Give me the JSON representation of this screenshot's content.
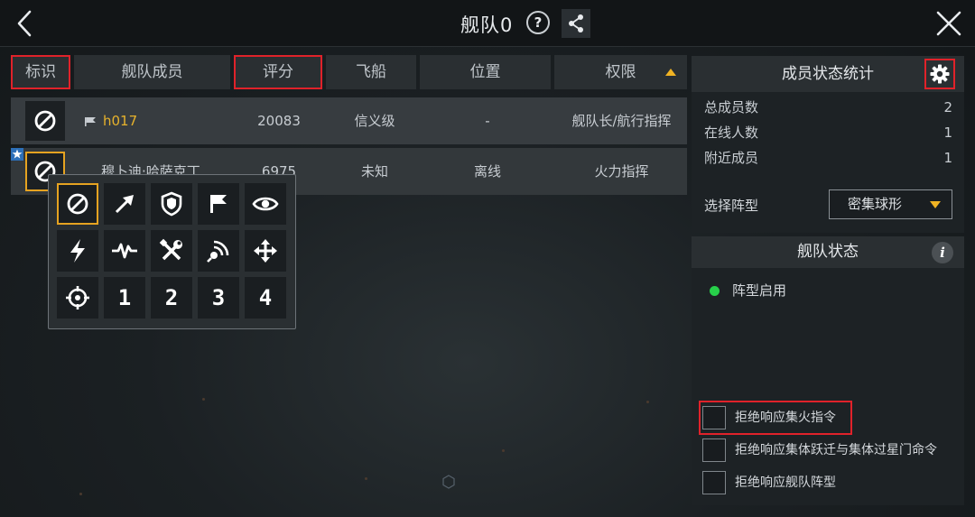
{
  "header": {
    "title": "舰队0",
    "help_label": "?"
  },
  "tabs": [
    {
      "label": "标识"
    },
    {
      "label": "舰队成员"
    },
    {
      "label": "评分"
    },
    {
      "label": "飞船"
    },
    {
      "label": "位置"
    },
    {
      "label": "权限"
    }
  ],
  "members": [
    {
      "name": "h017",
      "score": "20083",
      "ship": "信义级",
      "location": "-",
      "role": "舰队长/航行指挥"
    },
    {
      "name": "穆卜迪·哈萨克丁",
      "score": "6975",
      "ship": "未知",
      "location": "离线",
      "role": "火力指挥"
    }
  ],
  "mark_picker": {
    "icons": [
      "no-sign-icon",
      "arrow-icon",
      "shield-icon",
      "flag-icon",
      "eye-icon",
      "lightning-icon",
      "pulse-icon",
      "repair-tools-icon",
      "signal-icon",
      "move-icon",
      "crosshair-icon"
    ],
    "numbers": [
      "1",
      "2",
      "3",
      "4"
    ]
  },
  "panel": {
    "title": "成员状态统计",
    "stats": [
      {
        "label": "总成员数",
        "value": "2"
      },
      {
        "label": "在线人数",
        "value": "1"
      },
      {
        "label": "附近成员",
        "value": "1"
      }
    ],
    "formation_label": "选择阵型",
    "formation_value": "密集球形"
  },
  "fleet_status": {
    "title": "舰队状态",
    "info_label": "i",
    "status_text": "阵型启用",
    "status_color": "#27d04a",
    "options": [
      {
        "label": "拒绝响应集火指令"
      },
      {
        "label": "拒绝响应集体跃迁与集体过星门命令"
      },
      {
        "label": "拒绝响应舰队阵型"
      }
    ]
  },
  "colors": {
    "accent": "#f0b323",
    "highlight": "#e0222a",
    "leader_name": "#e6b22c"
  }
}
